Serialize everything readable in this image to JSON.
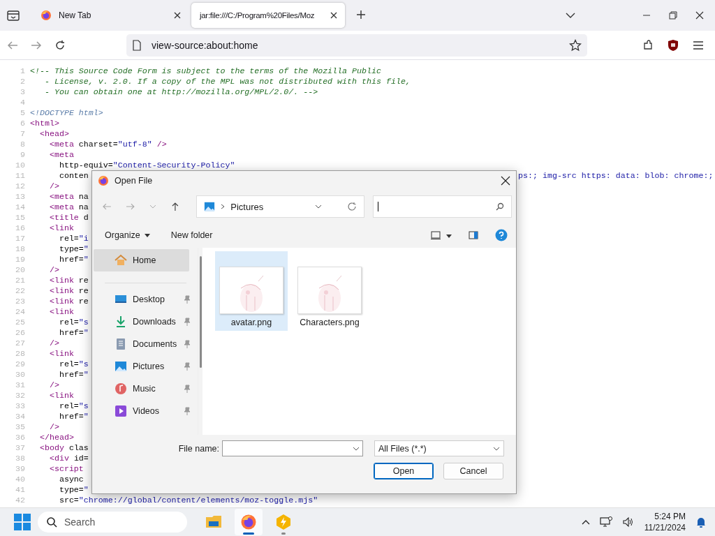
{
  "browser": {
    "tabs": [
      {
        "title": "New Tab",
        "selected": false
      },
      {
        "title": "jar:file:///C:/Program%20Files/Moz",
        "selected": true
      }
    ],
    "address": "view-source:about:home"
  },
  "source": {
    "lines": [
      {
        "n": "1",
        "tokens": [
          {
            "kind": "comment",
            "text": "<!-- This Source Code Form is subject to the terms of the Mozilla Public"
          }
        ]
      },
      {
        "n": "2",
        "tokens": [
          {
            "kind": "comment",
            "text": "   - License, v. 2.0. If a copy of the MPL was not distributed with this file,"
          }
        ]
      },
      {
        "n": "3",
        "tokens": [
          {
            "kind": "comment",
            "text": "   - You can obtain one at http://mozilla.org/MPL/2.0/. -->"
          }
        ]
      },
      {
        "n": "4"
      },
      {
        "n": "5",
        "tokens": [
          {
            "kind": "doctype",
            "text": "<!DOCTYPE html>"
          }
        ]
      },
      {
        "n": "6",
        "tokens": [
          {
            "kind": "tag",
            "text": "<html>"
          }
        ]
      },
      {
        "n": "7",
        "tokens": [
          {
            "kind": "tag",
            "text": "  <head>"
          }
        ]
      },
      {
        "n": "8",
        "tokens": [
          {
            "kind": "tag",
            "text": "    <meta "
          },
          {
            "kind": "attr",
            "text": "charset="
          },
          {
            "kind": "value",
            "text": "\"utf-8\""
          },
          {
            "kind": "tag",
            "text": " />"
          }
        ]
      },
      {
        "n": "9",
        "tokens": [
          {
            "kind": "tag",
            "text": "    <meta"
          }
        ]
      },
      {
        "n": "10",
        "tokens": [
          {
            "kind": "attr",
            "text": "      http-equiv="
          },
          {
            "kind": "value",
            "text": "\"Content-Security-Policy\""
          }
        ]
      },
      {
        "n": "11",
        "tokens": [
          {
            "kind": "attr",
            "text": "      conten"
          }
        ],
        "tail": [
          {
            "kind": "value",
            "text": "ps:; img-src https: data: blob: chrome:;"
          }
        ]
      },
      {
        "n": "12",
        "tokens": [
          {
            "kind": "tag",
            "text": "    />"
          }
        ]
      },
      {
        "n": "13",
        "tokens": [
          {
            "kind": "tag",
            "text": "    <meta "
          },
          {
            "kind": "attr",
            "text": "na"
          }
        ]
      },
      {
        "n": "14",
        "tokens": [
          {
            "kind": "tag",
            "text": "    <meta "
          },
          {
            "kind": "attr",
            "text": "na"
          }
        ]
      },
      {
        "n": "15",
        "tokens": [
          {
            "kind": "tag",
            "text": "    <title "
          },
          {
            "kind": "attr",
            "text": "d"
          }
        ]
      },
      {
        "n": "16",
        "tokens": [
          {
            "kind": "tag",
            "text": "    <link"
          }
        ]
      },
      {
        "n": "17",
        "tokens": [
          {
            "kind": "attr",
            "text": "      rel="
          },
          {
            "kind": "value",
            "text": "\"i"
          }
        ]
      },
      {
        "n": "18",
        "tokens": [
          {
            "kind": "attr",
            "text": "      type="
          },
          {
            "kind": "value",
            "text": "\""
          }
        ]
      },
      {
        "n": "19",
        "tokens": [
          {
            "kind": "attr",
            "text": "      href="
          },
          {
            "kind": "value",
            "text": "\""
          }
        ]
      },
      {
        "n": "20",
        "tokens": [
          {
            "kind": "tag",
            "text": "    />"
          }
        ]
      },
      {
        "n": "21",
        "tokens": [
          {
            "kind": "tag",
            "text": "    <link "
          },
          {
            "kind": "attr",
            "text": "re"
          }
        ]
      },
      {
        "n": "22",
        "tokens": [
          {
            "kind": "tag",
            "text": "    <link "
          },
          {
            "kind": "attr",
            "text": "re"
          }
        ]
      },
      {
        "n": "23",
        "tokens": [
          {
            "kind": "tag",
            "text": "    <link "
          },
          {
            "kind": "attr",
            "text": "re"
          }
        ]
      },
      {
        "n": "24",
        "tokens": [
          {
            "kind": "tag",
            "text": "    <link"
          }
        ]
      },
      {
        "n": "25",
        "tokens": [
          {
            "kind": "attr",
            "text": "      rel="
          },
          {
            "kind": "value",
            "text": "\"s"
          }
        ]
      },
      {
        "n": "26",
        "tokens": [
          {
            "kind": "attr",
            "text": "      href="
          },
          {
            "kind": "value",
            "text": "\""
          }
        ]
      },
      {
        "n": "27",
        "tokens": [
          {
            "kind": "tag",
            "text": "    />"
          }
        ]
      },
      {
        "n": "28",
        "tokens": [
          {
            "kind": "tag",
            "text": "    <link"
          }
        ]
      },
      {
        "n": "29",
        "tokens": [
          {
            "kind": "attr",
            "text": "      rel="
          },
          {
            "kind": "value",
            "text": "\"s"
          }
        ]
      },
      {
        "n": "30",
        "tokens": [
          {
            "kind": "attr",
            "text": "      href="
          },
          {
            "kind": "value",
            "text": "\""
          }
        ]
      },
      {
        "n": "31",
        "tokens": [
          {
            "kind": "tag",
            "text": "    />"
          }
        ]
      },
      {
        "n": "32",
        "tokens": [
          {
            "kind": "tag",
            "text": "    <link"
          }
        ]
      },
      {
        "n": "33",
        "tokens": [
          {
            "kind": "attr",
            "text": "      rel="
          },
          {
            "kind": "value",
            "text": "\"s"
          }
        ]
      },
      {
        "n": "34",
        "tokens": [
          {
            "kind": "attr",
            "text": "      href="
          },
          {
            "kind": "value",
            "text": "\""
          }
        ]
      },
      {
        "n": "35",
        "tokens": [
          {
            "kind": "tag",
            "text": "    />"
          }
        ]
      },
      {
        "n": "36",
        "tokens": [
          {
            "kind": "tag",
            "text": "  </head>"
          }
        ]
      },
      {
        "n": "37",
        "tokens": [
          {
            "kind": "tag",
            "text": "  <body "
          },
          {
            "kind": "attr",
            "text": "clas"
          }
        ]
      },
      {
        "n": "38",
        "tokens": [
          {
            "kind": "tag",
            "text": "    <div "
          },
          {
            "kind": "attr",
            "text": "id="
          }
        ]
      },
      {
        "n": "39",
        "tokens": [
          {
            "kind": "tag",
            "text": "    <script"
          }
        ]
      },
      {
        "n": "40",
        "tokens": [
          {
            "kind": "attr",
            "text": "      async"
          }
        ]
      },
      {
        "n": "41",
        "tokens": [
          {
            "kind": "attr",
            "text": "      type="
          },
          {
            "kind": "value",
            "text": "\""
          }
        ]
      },
      {
        "n": "42",
        "tokens": [
          {
            "kind": "attr",
            "text": "      src="
          },
          {
            "kind": "value",
            "text": "\"chrome://global/content/elements/moz-toggle.mjs\""
          }
        ]
      }
    ]
  },
  "dialog": {
    "title": "Open File",
    "location": "Pictures",
    "commands": [
      "Organize",
      "New folder"
    ],
    "nav": [
      {
        "label": "Home",
        "kind": "home",
        "selected": true,
        "pinned": false
      },
      {
        "label": "Desktop",
        "kind": "desktop",
        "selected": false,
        "pinned": true
      },
      {
        "label": "Downloads",
        "kind": "downloads",
        "selected": false,
        "pinned": true
      },
      {
        "label": "Documents",
        "kind": "documents",
        "selected": false,
        "pinned": true
      },
      {
        "label": "Pictures",
        "kind": "pictures",
        "selected": false,
        "pinned": true
      },
      {
        "label": "Music",
        "kind": "music",
        "selected": false,
        "pinned": true
      },
      {
        "label": "Videos",
        "kind": "videos",
        "selected": false,
        "pinned": true
      }
    ],
    "files": [
      {
        "name": "avatar.png",
        "selected": true
      },
      {
        "name": "Characters.png",
        "selected": false
      }
    ],
    "file_name_label": "File name:",
    "file_type": "All Files (*.*)",
    "buttons": [
      {
        "label": "Open",
        "default": true
      },
      {
        "label": "Cancel",
        "default": false
      }
    ]
  },
  "taskbar": {
    "search_placeholder": "Search",
    "apps": [
      {
        "kind": "explorer",
        "running": false,
        "active": false
      },
      {
        "kind": "firefox",
        "running": true,
        "active": true
      },
      {
        "kind": "app",
        "running": true,
        "active": false
      }
    ],
    "time": "5:24 PM",
    "date": "11/21/2024"
  }
}
